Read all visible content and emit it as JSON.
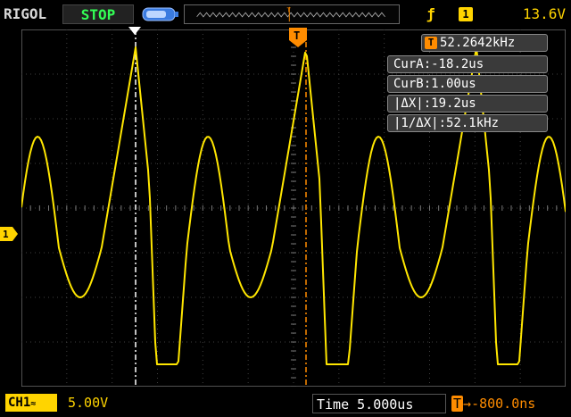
{
  "header": {
    "brand": "RIGOL",
    "run_state": "STOP",
    "trigger_edge": "rising-edge-icon",
    "trigger_source": "1",
    "trigger_level": "13.6V"
  },
  "channel": {
    "marker": "1",
    "label": "CH1",
    "coupling_symbol": "≈",
    "volts_per_div": "5.00V"
  },
  "timebase": {
    "label": "Time",
    "value": "5.000us",
    "delay_symbol": "T",
    "delay": "-800.0ns"
  },
  "measurements": {
    "frequency_badge": "T",
    "frequency": "52.2642kHz",
    "cur_a": "CurA:-18.2us",
    "cur_b": "CurB:1.00us",
    "delta_x": "|ΔX|:19.2us",
    "inv_delta_x": "|1/ΔX|:52.1kHz"
  },
  "colors": {
    "trace": "#ffe600",
    "grid": "#404040",
    "cursor_a": "#ffffff",
    "cursor_b": "#ff8c00",
    "run_state": "#33ff55"
  },
  "trigger_marker_label": "T"
}
